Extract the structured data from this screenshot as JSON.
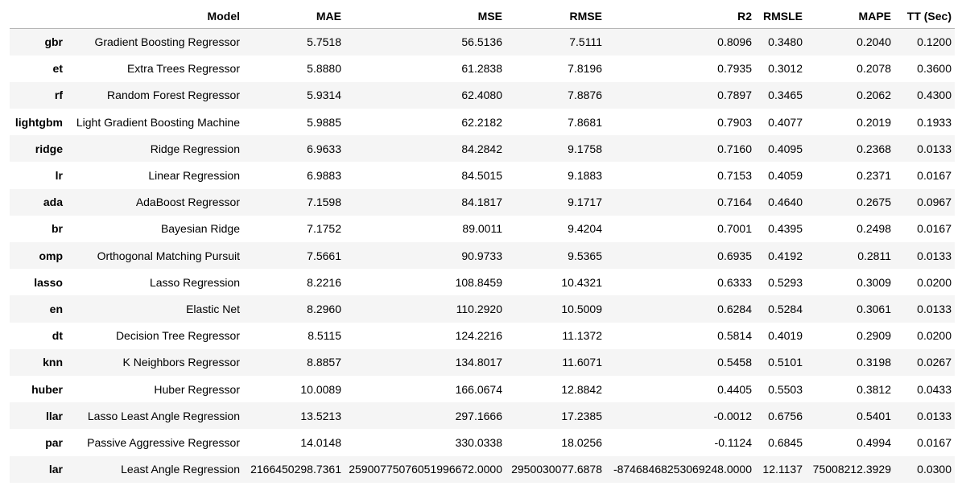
{
  "table": {
    "headers": {
      "index": "",
      "model": "Model",
      "mae": "MAE",
      "mse": "MSE",
      "rmse": "RMSE",
      "r2": "R2",
      "rmsle": "RMSLE",
      "mape": "MAPE",
      "tt": "TT (Sec)"
    },
    "rows": [
      {
        "id": "gbr",
        "model": "Gradient Boosting Regressor",
        "mae": "5.7518",
        "mse": "56.5136",
        "rmse": "7.5111",
        "r2": "0.8096",
        "rmsle": "0.3480",
        "mape": "0.2040",
        "tt": "0.1200"
      },
      {
        "id": "et",
        "model": "Extra Trees Regressor",
        "mae": "5.8880",
        "mse": "61.2838",
        "rmse": "7.8196",
        "r2": "0.7935",
        "rmsle": "0.3012",
        "mape": "0.2078",
        "tt": "0.3600"
      },
      {
        "id": "rf",
        "model": "Random Forest Regressor",
        "mae": "5.9314",
        "mse": "62.4080",
        "rmse": "7.8876",
        "r2": "0.7897",
        "rmsle": "0.3465",
        "mape": "0.2062",
        "tt": "0.4300"
      },
      {
        "id": "lightgbm",
        "model": "Light Gradient Boosting Machine",
        "mae": "5.9885",
        "mse": "62.2182",
        "rmse": "7.8681",
        "r2": "0.7903",
        "rmsle": "0.4077",
        "mape": "0.2019",
        "tt": "0.1933"
      },
      {
        "id": "ridge",
        "model": "Ridge Regression",
        "mae": "6.9633",
        "mse": "84.2842",
        "rmse": "9.1758",
        "r2": "0.7160",
        "rmsle": "0.4095",
        "mape": "0.2368",
        "tt": "0.0133"
      },
      {
        "id": "lr",
        "model": "Linear Regression",
        "mae": "6.9883",
        "mse": "84.5015",
        "rmse": "9.1883",
        "r2": "0.7153",
        "rmsle": "0.4059",
        "mape": "0.2371",
        "tt": "0.0167"
      },
      {
        "id": "ada",
        "model": "AdaBoost Regressor",
        "mae": "7.1598",
        "mse": "84.1817",
        "rmse": "9.1717",
        "r2": "0.7164",
        "rmsle": "0.4640",
        "mape": "0.2675",
        "tt": "0.0967"
      },
      {
        "id": "br",
        "model": "Bayesian Ridge",
        "mae": "7.1752",
        "mse": "89.0011",
        "rmse": "9.4204",
        "r2": "0.7001",
        "rmsle": "0.4395",
        "mape": "0.2498",
        "tt": "0.0167"
      },
      {
        "id": "omp",
        "model": "Orthogonal Matching Pursuit",
        "mae": "7.5661",
        "mse": "90.9733",
        "rmse": "9.5365",
        "r2": "0.6935",
        "rmsle": "0.4192",
        "mape": "0.2811",
        "tt": "0.0133"
      },
      {
        "id": "lasso",
        "model": "Lasso Regression",
        "mae": "8.2216",
        "mse": "108.8459",
        "rmse": "10.4321",
        "r2": "0.6333",
        "rmsle": "0.5293",
        "mape": "0.3009",
        "tt": "0.0200"
      },
      {
        "id": "en",
        "model": "Elastic Net",
        "mae": "8.2960",
        "mse": "110.2920",
        "rmse": "10.5009",
        "r2": "0.6284",
        "rmsle": "0.5284",
        "mape": "0.3061",
        "tt": "0.0133"
      },
      {
        "id": "dt",
        "model": "Decision Tree Regressor",
        "mae": "8.5115",
        "mse": "124.2216",
        "rmse": "11.1372",
        "r2": "0.5814",
        "rmsle": "0.4019",
        "mape": "0.2909",
        "tt": "0.0200"
      },
      {
        "id": "knn",
        "model": "K Neighbors Regressor",
        "mae": "8.8857",
        "mse": "134.8017",
        "rmse": "11.6071",
        "r2": "0.5458",
        "rmsle": "0.5101",
        "mape": "0.3198",
        "tt": "0.0267"
      },
      {
        "id": "huber",
        "model": "Huber Regressor",
        "mae": "10.0089",
        "mse": "166.0674",
        "rmse": "12.8842",
        "r2": "0.4405",
        "rmsle": "0.5503",
        "mape": "0.3812",
        "tt": "0.0433"
      },
      {
        "id": "llar",
        "model": "Lasso Least Angle Regression",
        "mae": "13.5213",
        "mse": "297.1666",
        "rmse": "17.2385",
        "r2": "-0.0012",
        "rmsle": "0.6756",
        "mape": "0.5401",
        "tt": "0.0133"
      },
      {
        "id": "par",
        "model": "Passive Aggressive Regressor",
        "mae": "14.0148",
        "mse": "330.0338",
        "rmse": "18.0256",
        "r2": "-0.1124",
        "rmsle": "0.6845",
        "mape": "0.4994",
        "tt": "0.0167"
      },
      {
        "id": "lar",
        "model": "Least Angle Regression",
        "mae": "2166450298.7361",
        "mse": "25900775076051996672.0000",
        "rmse": "2950030077.6878",
        "r2": "-87468468253069248.0000",
        "rmsle": "12.1137",
        "mape": "75008212.3929",
        "tt": "0.0300"
      }
    ]
  }
}
